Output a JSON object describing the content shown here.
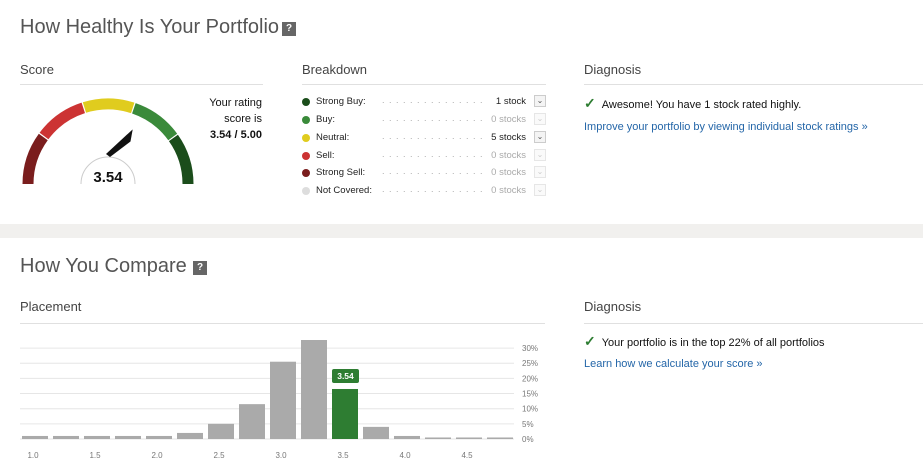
{
  "health": {
    "title": "How Healthy Is Your Portfolio",
    "help_label": "?",
    "score_heading": "Score",
    "breakdown_heading": "Breakdown",
    "diagnosis_heading": "Diagnosis",
    "gauge_value": "3.54",
    "score_line1": "Your rating",
    "score_line2": "score is",
    "score_line3": "3.54 / 5.00",
    "breakdown": [
      {
        "name": "Strong Buy:",
        "count": "1 stock",
        "color": "#1b4d1b",
        "active": true
      },
      {
        "name": "Buy:",
        "count": "0 stocks",
        "color": "#3a8a3a",
        "active": false
      },
      {
        "name": "Neutral:",
        "count": "5 stocks",
        "color": "#e0cc1e",
        "active": true
      },
      {
        "name": "Sell:",
        "count": "0 stocks",
        "color": "#cc3333",
        "active": false
      },
      {
        "name": "Strong Sell:",
        "count": "0 stocks",
        "color": "#7a1d1d",
        "active": false
      },
      {
        "name": "Not Covered:",
        "count": "0 stocks",
        "color": "#dddddd",
        "active": false
      }
    ],
    "dots": ". . . . . . . . . . . . . . . . . . . . . .",
    "chevron": "⌄",
    "diagnosis_text": "Awesome! You have 1 stock rated highly.",
    "diagnosis_link": "Improve your portfolio by viewing individual stock ratings »",
    "check": "✓"
  },
  "compare": {
    "title": "How You Compare",
    "help_label": "?",
    "placement_heading": "Placement",
    "diagnosis_heading": "Diagnosis",
    "diagnosis_text": "Your portfolio is in the top 22% of all portfolios",
    "diagnosis_link": "Learn how we calculate your score »",
    "check": "✓"
  },
  "chart_data": {
    "type": "bar",
    "x": [
      1.0,
      1.25,
      1.5,
      1.75,
      2.0,
      2.25,
      2.5,
      2.75,
      3.0,
      3.25,
      3.5,
      3.75,
      4.0,
      4.25,
      4.5,
      4.75
    ],
    "values": [
      1,
      1,
      1,
      1,
      1,
      2,
      5,
      11.5,
      25.5,
      33.5,
      16.5,
      4,
      1,
      0.5,
      0.5,
      0.5
    ],
    "highlight_index": 10,
    "highlight_label": "3.54",
    "xticks": [
      "1.0",
      "1.5",
      "2.0",
      "2.5",
      "3.0",
      "3.5",
      "4.0",
      "4.5"
    ],
    "yticks": [
      "0%",
      "5%",
      "10%",
      "15%",
      "20%",
      "25%",
      "30%"
    ],
    "ylim": [
      0,
      32
    ],
    "grid": true,
    "bar_color": "#aaaaaa",
    "highlight_color": "#2e7d32"
  },
  "gauge": {
    "score": 3.54,
    "min": 1,
    "max": 5,
    "segments": [
      {
        "from": 1.0,
        "to": 1.8,
        "color": "#7a1d1d"
      },
      {
        "from": 1.8,
        "to": 2.6,
        "color": "#cc3333"
      },
      {
        "from": 2.6,
        "to": 3.4,
        "color": "#e0cc1e"
      },
      {
        "from": 3.4,
        "to": 4.2,
        "color": "#3a8a3a"
      },
      {
        "from": 4.2,
        "to": 5.0,
        "color": "#1b4d1b"
      }
    ]
  }
}
